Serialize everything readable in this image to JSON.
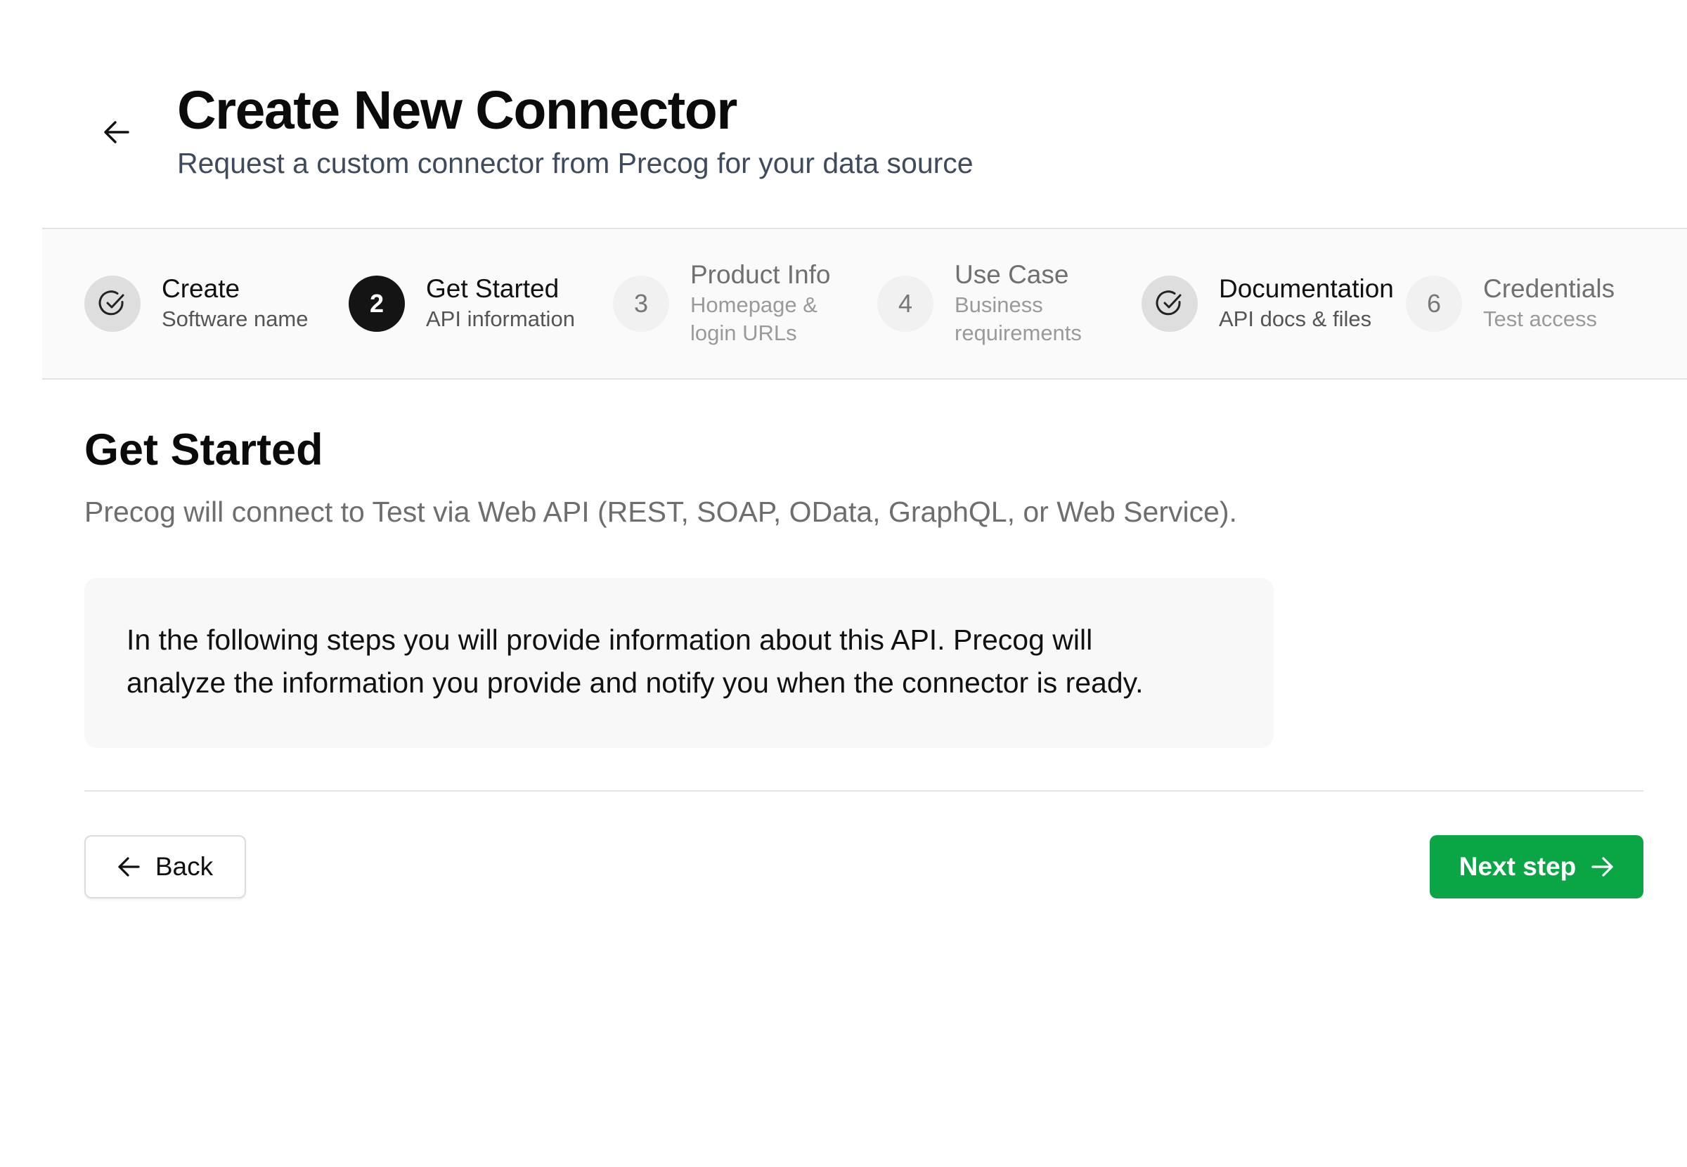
{
  "header": {
    "back_icon": "arrow-left-icon",
    "title": "Create New Connector",
    "subtitle": "Request a custom connector from Precog for your data source"
  },
  "stepper": {
    "steps": [
      {
        "state": "completed",
        "icon": "check-circle-icon",
        "title": "Create",
        "desc": "Software name"
      },
      {
        "state": "active",
        "number": "2",
        "title": "Get Started",
        "desc": "API information"
      },
      {
        "state": "pending",
        "number": "3",
        "title": "Product Info",
        "desc_line1": "Homepage &",
        "desc_line2": "login URLs"
      },
      {
        "state": "pending",
        "number": "4",
        "title": "Use Case",
        "desc_line1": "Business",
        "desc_line2": "requirements"
      },
      {
        "state": "completed",
        "icon": "check-circle-icon",
        "title": "Documentation",
        "desc": "API docs & files"
      },
      {
        "state": "pending",
        "number": "6",
        "title": "Credentials",
        "desc": "Test access"
      }
    ]
  },
  "main": {
    "title": "Get Started",
    "description": "Precog will connect to Test via Web API (REST, SOAP, OData, GraphQL, or Web Service).",
    "info_line1": "In the following steps you will provide information about this API. Precog will",
    "info_line2": "analyze the information you provide and notify you when the connector is ready."
  },
  "buttons": {
    "back_label": "Back",
    "next_label": "Next step",
    "back_icon": "arrow-left-icon",
    "next_icon": "arrow-right-icon"
  },
  "colors": {
    "primary": "#0aa645",
    "active_step": "#141414",
    "completed_step": "#dedede",
    "pending_step": "#f1f1f1"
  }
}
